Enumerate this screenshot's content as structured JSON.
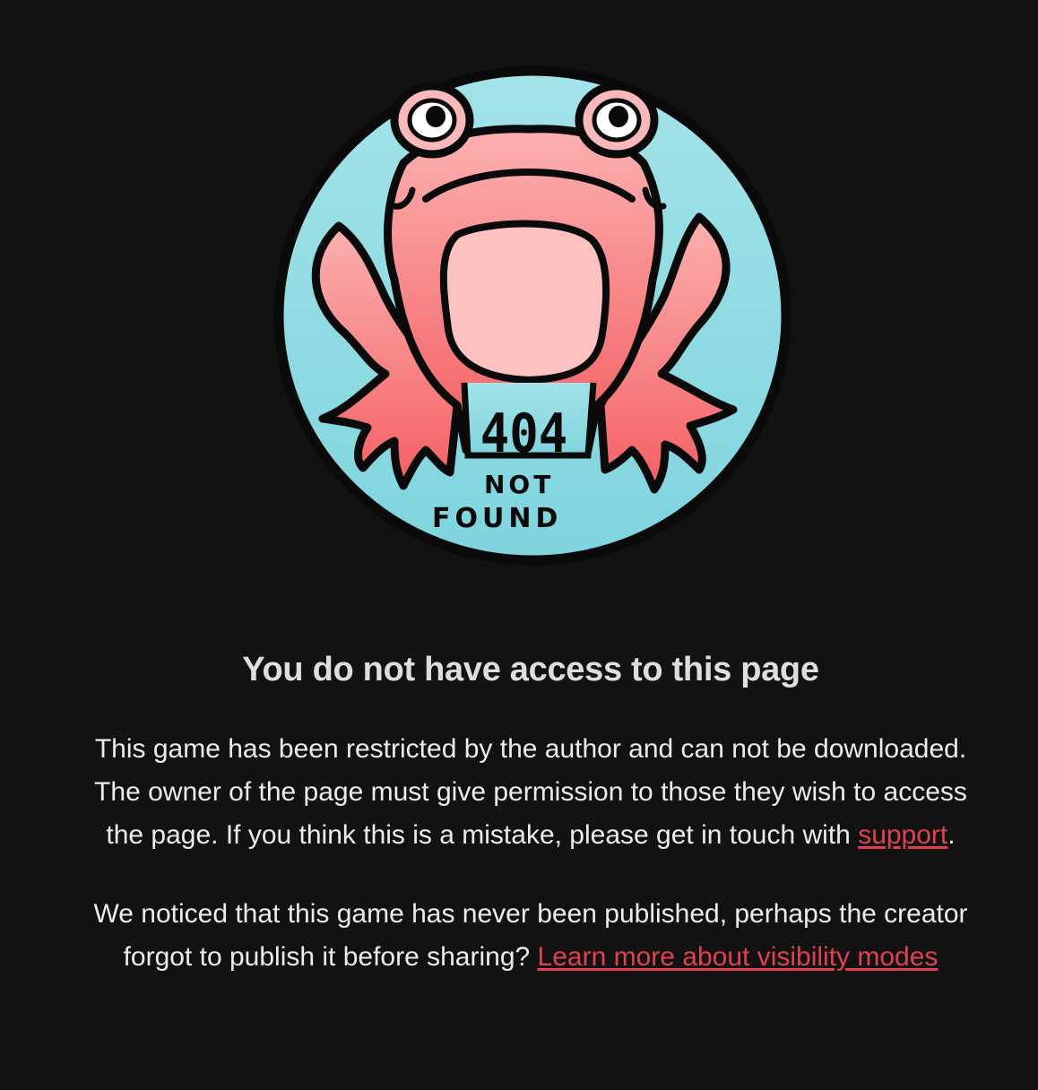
{
  "illustration": {
    "icon": "frog-404-icon",
    "code_text": "404",
    "line1": "NOT",
    "line2": "FOUND"
  },
  "heading": "You do not have access to this page",
  "paragraph1": {
    "text": "This game has been restricted by the author and can not be downloaded. The owner of the page must give permission to those they wish to access the page. If you think this is a mistake, please get in touch with ",
    "link_label": "support",
    "suffix": "."
  },
  "paragraph2": {
    "text": "We noticed that this game has never been published, perhaps the creator forgot to publish it before sharing? ",
    "link_label": "Learn more about visibility modes"
  },
  "colors": {
    "background": "#121212",
    "link": "#e0414f",
    "badge_teal": "#8fdbe2",
    "frog_pink": "#f78a8a"
  }
}
